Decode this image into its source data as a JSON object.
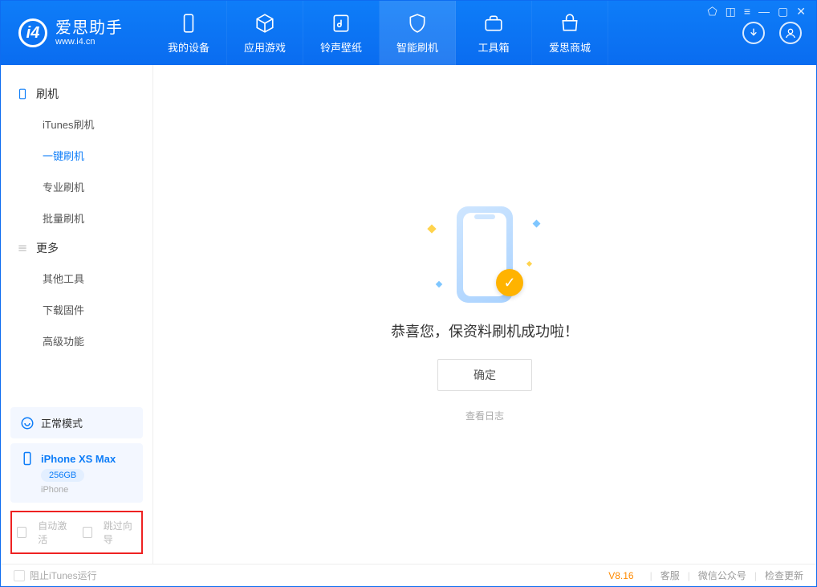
{
  "header": {
    "app_title": "爱思助手",
    "app_sub": "www.i4.cn",
    "nav": [
      {
        "label": "我的设备"
      },
      {
        "label": "应用游戏"
      },
      {
        "label": "铃声壁纸"
      },
      {
        "label": "智能刷机"
      },
      {
        "label": "工具箱"
      },
      {
        "label": "爱思商城"
      }
    ]
  },
  "sidebar": {
    "group1_title": "刷机",
    "group1_items": [
      "iTunes刷机",
      "一键刷机",
      "专业刷机",
      "批量刷机"
    ],
    "group2_title": "更多",
    "group2_items": [
      "其他工具",
      "下载固件",
      "高级功能"
    ],
    "mode_label": "正常模式",
    "device_name": "iPhone XS Max",
    "device_capacity": "256GB",
    "device_type": "iPhone",
    "opt_auto_activate": "自动激活",
    "opt_skip_guide": "跳过向导"
  },
  "main": {
    "success_text": "恭喜您，保资料刷机成功啦！",
    "ok_label": "确定",
    "view_log": "查看日志"
  },
  "footer": {
    "block_itunes": "阻止iTunes运行",
    "version": "V8.16",
    "links": [
      "客服",
      "微信公众号",
      "检查更新"
    ]
  }
}
